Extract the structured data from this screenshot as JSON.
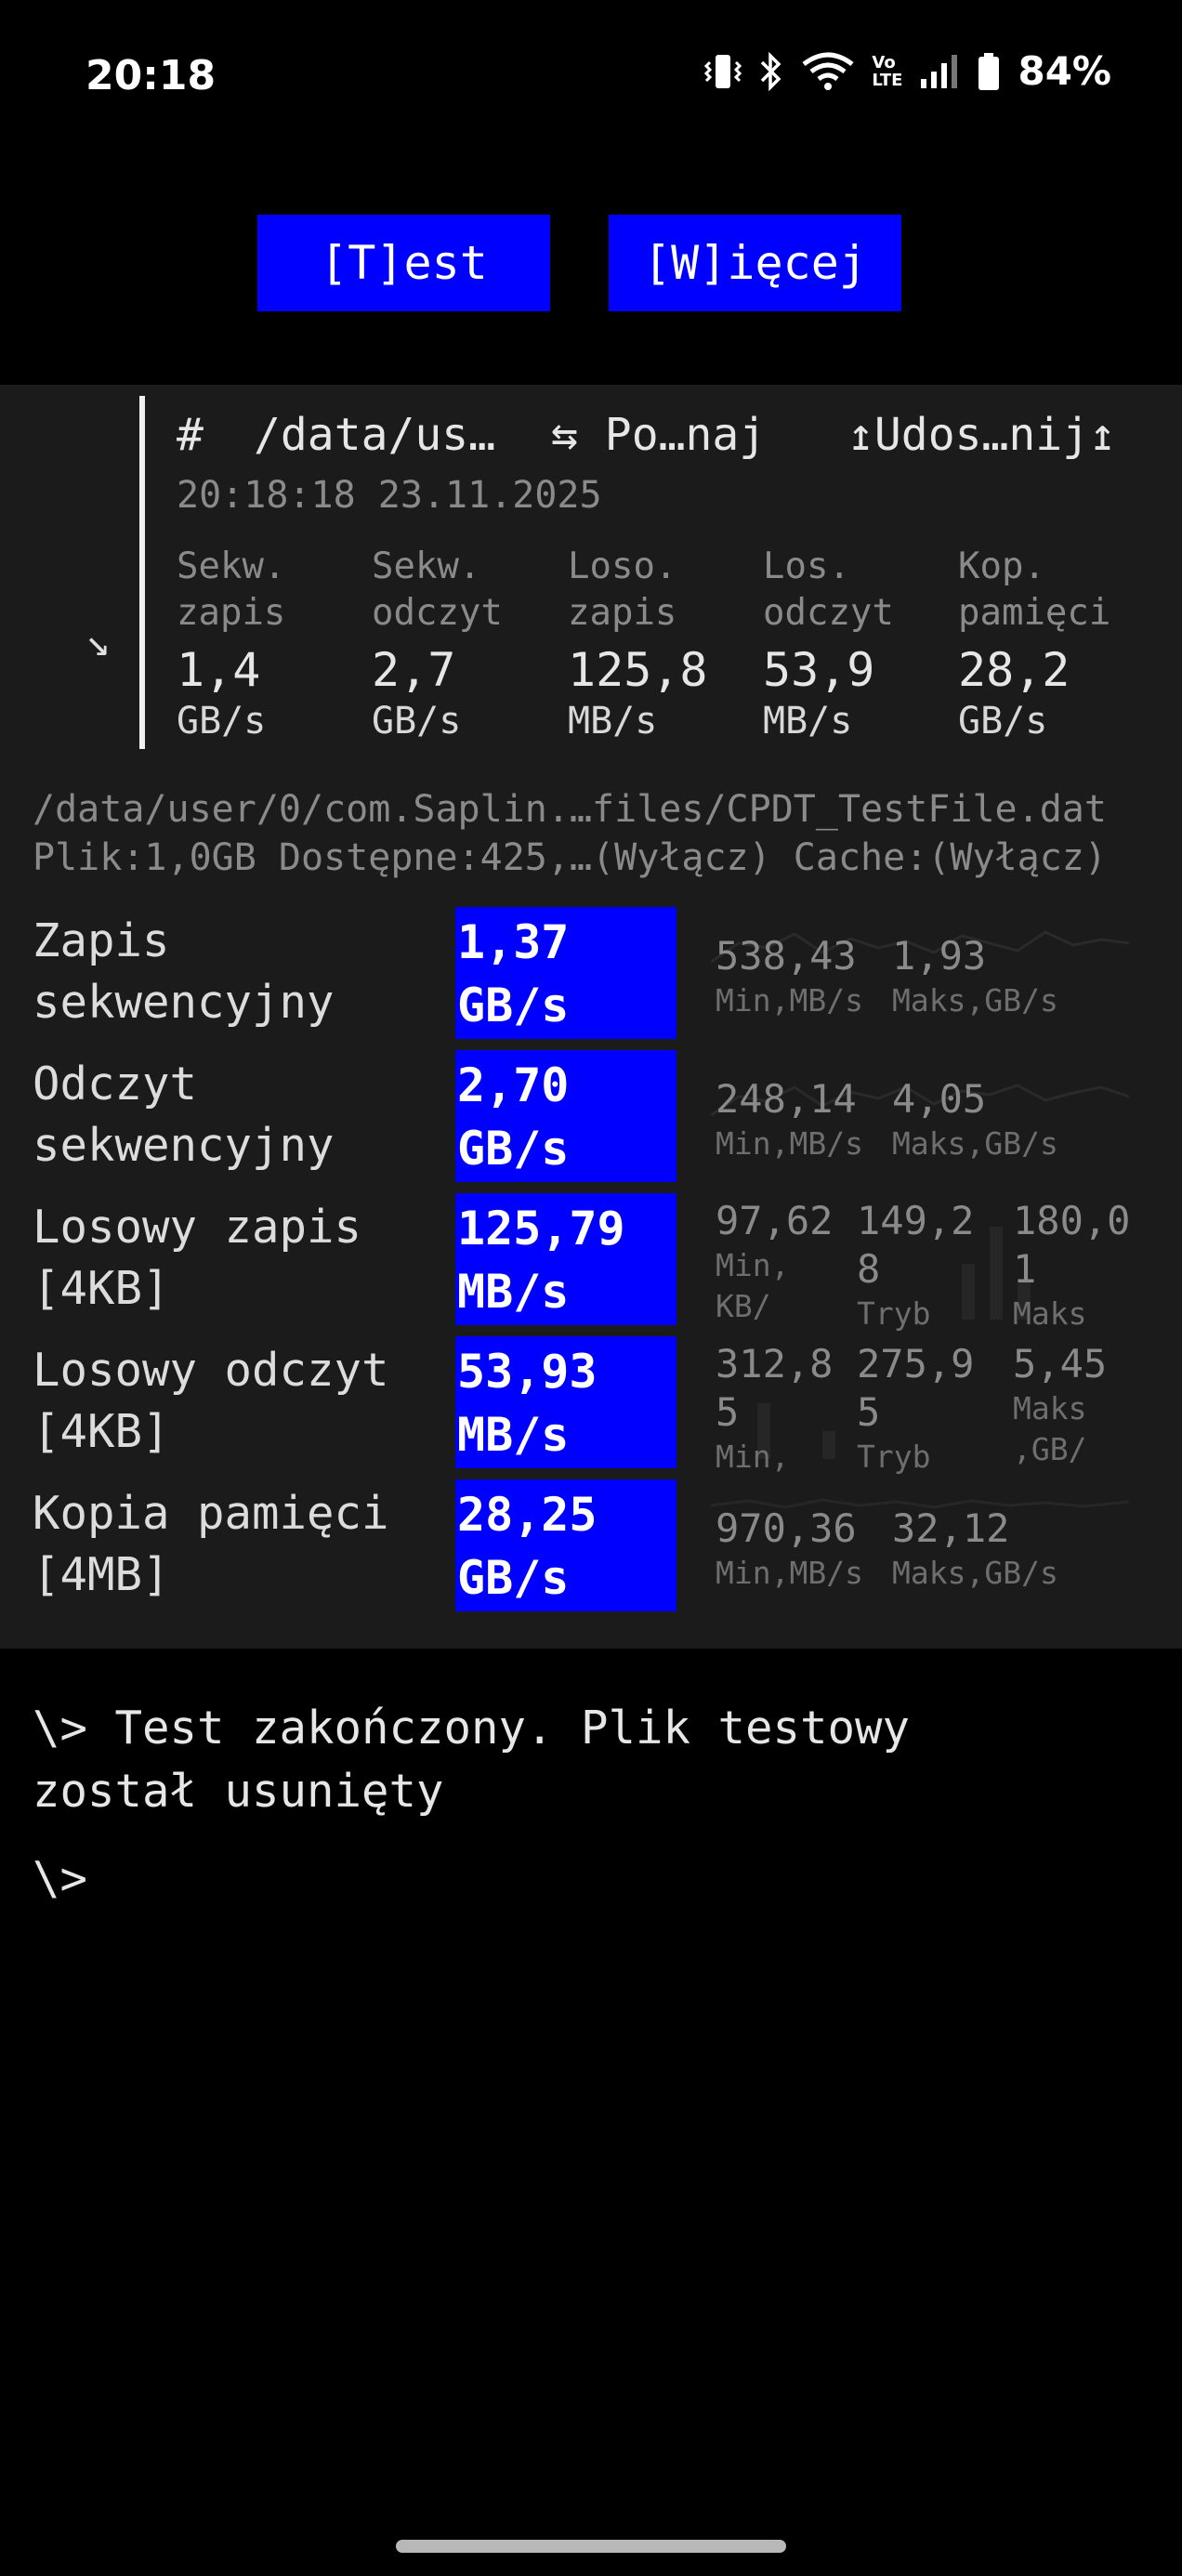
{
  "status_bar": {
    "time": "20:18",
    "battery": "84%",
    "icons": [
      "vibrate-icon",
      "bluetooth-icon",
      "wifi-icon",
      "volte-icon",
      "signal-icon",
      "battery-icon"
    ],
    "volte_line1": "Vo",
    "volte_line2": "LTE"
  },
  "buttons": {
    "test": "[T]est",
    "more": "[W]ięcej"
  },
  "card": {
    "hash": "#",
    "path": "/data/us…",
    "compare": "⇆ Po…naj",
    "share": "↥Udos…nij↥",
    "datetime": "20:18:18 23.11.2025",
    "collapse": "↘",
    "metrics": [
      {
        "label1": "Sekw.",
        "label2": "zapis",
        "value": "1,4",
        "unit": "GB/s"
      },
      {
        "label1": "Sekw.",
        "label2": "odczyt",
        "value": "2,7",
        "unit": "GB/s"
      },
      {
        "label1": "Loso.",
        "label2": "zapis",
        "value": "125,8",
        "unit": "MB/s"
      },
      {
        "label1": "Los.",
        "label2": "odczyt",
        "value": "53,9",
        "unit": "MB/s"
      },
      {
        "label1": "Kop.",
        "label2": "pamięci",
        "value": "28,2",
        "unit": "GB/s"
      }
    ]
  },
  "file_info": {
    "path": "/data/user/0/com.Saplin.…files/CPDT_TestFile.dat",
    "details": "Plik:1,0GB Dostępne:425,…(Wyłącz) Cache:(Wyłącz)"
  },
  "results": [
    {
      "label1": "Zapis",
      "label2": "sekwencyjny",
      "value": "1,37",
      "unit": "GB/s",
      "stats": [
        {
          "value": "538,43",
          "label": "Min,MB/s"
        },
        {
          "value": "1,93",
          "label": "Maks,GB/s"
        }
      ]
    },
    {
      "label1": "Odczyt",
      "label2": "sekwencyjny",
      "value": "2,70",
      "unit": "GB/s",
      "stats": [
        {
          "value": "248,14",
          "label": "Min,MB/s"
        },
        {
          "value": "4,05",
          "label": "Maks,GB/s"
        }
      ]
    },
    {
      "label1": "Losowy zapis",
      "label2": "[4KB]",
      "value": "125,79",
      "unit": "MB/s",
      "stats": [
        {
          "v1": "97,62",
          "l1": "Min,",
          "l2": "KB/"
        },
        {
          "v1": "149,2",
          "v2": "8",
          "l1": "Tryb"
        },
        {
          "v1": "180,0",
          "v2": "1",
          "l1": "Maks"
        }
      ]
    },
    {
      "label1": "Losowy odczyt",
      "label2": "[4KB]",
      "value": "53,93",
      "unit": "MB/s",
      "stats": [
        {
          "v1": "312,8",
          "v2": "5",
          "l1": "Min,"
        },
        {
          "v1": "275,9",
          "v2": "5",
          "l1": "Tryb"
        },
        {
          "v1": "5,45",
          "l1": "Maks",
          "l2": ",GB/"
        }
      ]
    },
    {
      "label1": "Kopia pamięci",
      "label2": "[4MB]",
      "value": "28,25",
      "unit": "GB/s",
      "stats": [
        {
          "value": "970,36",
          "label": "Min,MB/s"
        },
        {
          "value": "32,12",
          "label": "Maks,GB/s"
        }
      ]
    }
  ],
  "console": {
    "line1": "\\> Test zakończony. Plik testowy",
    "line2": "został usunięty",
    "prompt": "\\>"
  },
  "colors": {
    "background": "#000000",
    "panel": "#1b1b1b",
    "accent_blue": "#0000ff",
    "muted_text": "#8a8a8a"
  }
}
